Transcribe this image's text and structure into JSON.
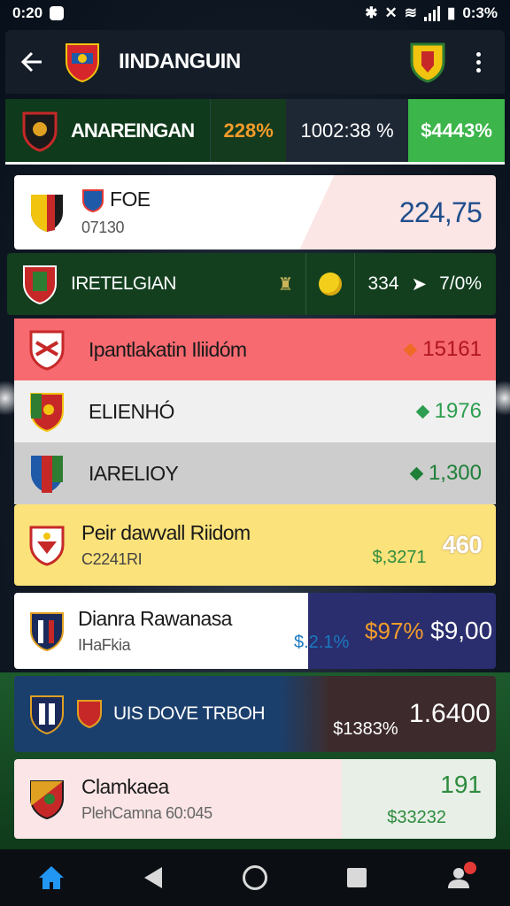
{
  "status_bar": {
    "time": "0:20",
    "battery": "0:3%"
  },
  "header": {
    "title": "IINDANGUIN",
    "back_icon": "arrow-left-icon",
    "menu_icon": "more-vert-icon"
  },
  "featured": {
    "team": "ANAREINGAN",
    "percent": "228%",
    "time": "1002:38 %",
    "amount": "$4443%"
  },
  "cards": [
    {
      "name": "FOE",
      "sub": "07130",
      "value": "224,75"
    },
    {
      "name": "IRETELGIAN",
      "stat": "334",
      "change": "7/0%"
    }
  ],
  "rows": [
    {
      "name": "Ipantlakatin Iliidóm",
      "value": "15161"
    },
    {
      "name": "ELIENHÓ",
      "value": "1976"
    },
    {
      "name": "IARELIOY",
      "value": "1,300"
    }
  ],
  "card_yellow": {
    "name": "Peir dawvall Riidom",
    "sub": "C2241RI",
    "mid": "$,3271",
    "value": "460"
  },
  "card_navy": {
    "name": "Dianra Rawanasa",
    "sub": "IHaFkia",
    "mid": "$.2.1%",
    "percent": "$97%",
    "amount": "$9,00"
  },
  "card_blue": {
    "name": "UIS DOVE TRBOH",
    "mid": "$1383%",
    "amount": "1.6400"
  },
  "card_pink": {
    "name": "Clamkaea",
    "sub": "PlehCamna 60:045",
    "amount": "191",
    "mid": "$33232"
  },
  "nav": {
    "items": [
      "home-icon",
      "back-icon",
      "home-circle-icon",
      "recents-icon",
      "profile-icon"
    ]
  },
  "colors": {
    "accent_green": "#3cb54a",
    "dark_bg": "#151d28",
    "row_red": "#f66a70",
    "row_yellow": "#fbe27a",
    "navy": "#2a2e6e"
  }
}
